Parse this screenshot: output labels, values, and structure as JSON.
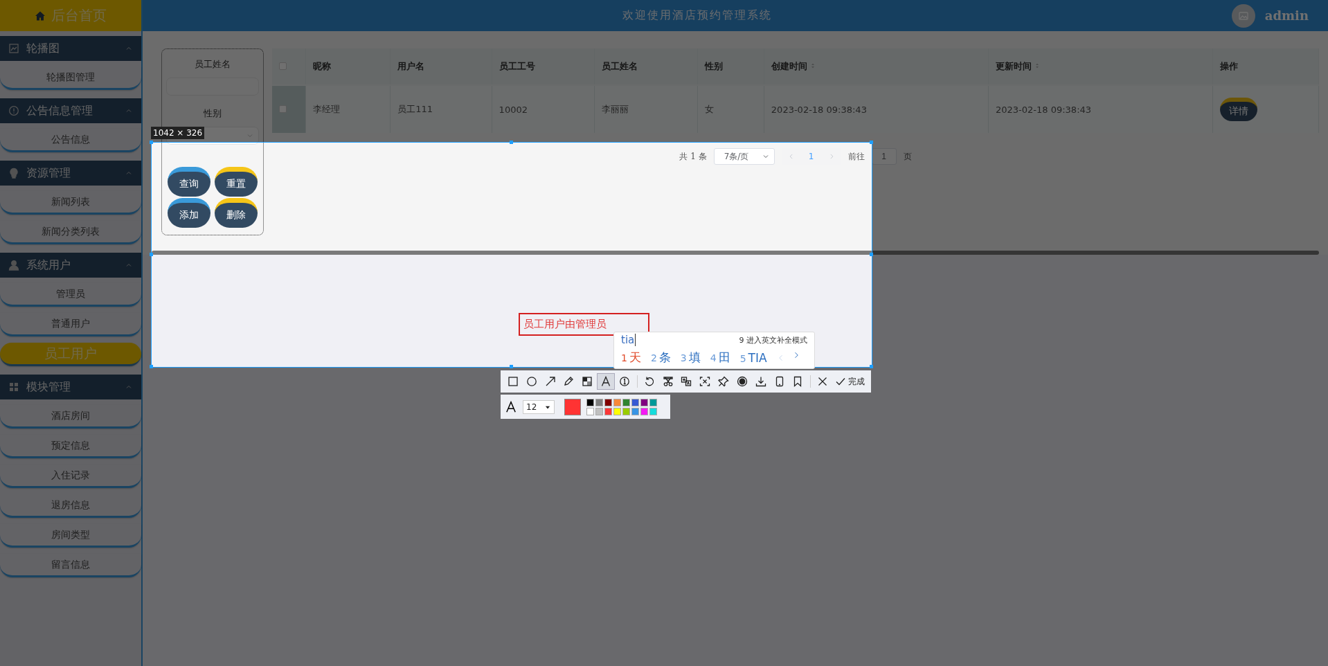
{
  "sidebar": {
    "home": {
      "label": "后台首页"
    },
    "groups": [
      {
        "title": "轮播图",
        "expanded": true,
        "items": [
          {
            "label": "轮播图管理",
            "selected": false
          }
        ]
      },
      {
        "title": "公告信息管理",
        "expanded": true,
        "items": [
          {
            "label": "公告信息",
            "selected": false
          }
        ]
      },
      {
        "title": "资源管理",
        "expanded": true,
        "items": [
          {
            "label": "新闻列表",
            "selected": false
          },
          {
            "label": "新闻分类列表",
            "selected": false
          }
        ]
      },
      {
        "title": "系统用户",
        "expanded": true,
        "items": [
          {
            "label": "管理员",
            "selected": false
          },
          {
            "label": "普通用户",
            "selected": false
          },
          {
            "label": "员工用户",
            "selected": true
          }
        ]
      },
      {
        "title": "模块管理",
        "expanded": true,
        "items": [
          {
            "label": "酒店房间",
            "selected": false
          },
          {
            "label": "预定信息",
            "selected": false
          },
          {
            "label": "入住记录",
            "selected": false
          },
          {
            "label": "退房信息",
            "selected": false
          },
          {
            "label": "房间类型",
            "selected": false
          },
          {
            "label": "留言信息",
            "selected": false
          }
        ]
      }
    ]
  },
  "header": {
    "title": "欢迎使用酒店预约管理系统",
    "user": "admin"
  },
  "search_panel": {
    "fields": [
      {
        "label": "员工姓名",
        "kind": "input"
      },
      {
        "label": "性别",
        "kind": "select"
      }
    ],
    "buttons": [
      {
        "label": "查询",
        "color": "#3a9ad9"
      },
      {
        "label": "重置",
        "color": "#f5c518"
      },
      {
        "label": "添加",
        "color": "#3a9ad9"
      },
      {
        "label": "删除",
        "color": "#f5c518"
      }
    ]
  },
  "table": {
    "all_checked": false,
    "columns": [
      {
        "label": "昵称",
        "sortable": false
      },
      {
        "label": "用户名",
        "sortable": false
      },
      {
        "label": "员工工号",
        "sortable": false
      },
      {
        "label": "员工姓名",
        "sortable": false
      },
      {
        "label": "性别",
        "sortable": false
      },
      {
        "label": "创建时间",
        "sortable": true
      },
      {
        "label": "更新时间",
        "sortable": true
      },
      {
        "label": "操作",
        "sortable": false
      }
    ],
    "rows": [
      {
        "checked": false,
        "cells": [
          "李经理",
          "员工111",
          "10002",
          "李丽丽",
          "女",
          "2023-02-18 09:38:43",
          "2023-02-18 09:38:43"
        ],
        "action": "详情"
      }
    ]
  },
  "pagination": {
    "total": "共 1 条",
    "page_size": "7条/页",
    "pages": [
      {
        "label": "1",
        "selected": true
      }
    ],
    "goto_label": "前往",
    "goto_value": "1",
    "goto_suffix": "页"
  },
  "capture": {
    "size_label": "1042 × 326",
    "annotation_text": "员工用户由管理员",
    "ime": {
      "input": "tia",
      "hint": "9 进入英文补全模式",
      "candidates": [
        {
          "number": "1",
          "text": "天",
          "selected": true
        },
        {
          "number": "2",
          "text": "条",
          "selected": false
        },
        {
          "number": "3",
          "text": "填",
          "selected": false
        },
        {
          "number": "4",
          "text": "田",
          "selected": false
        },
        {
          "number": "5",
          "text": "TIA",
          "selected": false
        }
      ]
    },
    "tool_groups": [
      {
        "tools": [
          {
            "kind": "rect",
            "selected": false
          },
          {
            "kind": "ellipse",
            "selected": false
          },
          {
            "kind": "arrow",
            "selected": false
          },
          {
            "kind": "pencil",
            "selected": false
          },
          {
            "kind": "mosaic",
            "selected": false
          },
          {
            "kind": "text",
            "selected": true
          },
          {
            "kind": "number",
            "selected": false
          }
        ]
      },
      {
        "tools": [
          {
            "kind": "undo",
            "selected": false
          },
          {
            "kind": "scissors",
            "selected": false
          },
          {
            "kind": "translate",
            "selected": false
          },
          {
            "kind": "ocr",
            "selected": false
          },
          {
            "kind": "pin",
            "selected": false
          },
          {
            "kind": "record",
            "selected": false
          },
          {
            "kind": "download",
            "selected": false
          },
          {
            "kind": "phone",
            "selected": false
          },
          {
            "kind": "bookmark",
            "selected": false
          }
        ]
      },
      {
        "tools": [
          {
            "kind": "close",
            "selected": false
          }
        ]
      }
    ],
    "done_label": "完成",
    "font_size": "12",
    "current_swatch": {
      "color": "#ff3333"
    },
    "palette": [
      {
        "color": "#000000",
        "selected": false
      },
      {
        "color": "#808080",
        "selected": false
      },
      {
        "color": "#800000",
        "selected": false
      },
      {
        "color": "#f7883a",
        "selected": false
      },
      {
        "color": "#308430",
        "selected": false
      },
      {
        "color": "#385ad3",
        "selected": false
      },
      {
        "color": "#800080",
        "selected": false
      },
      {
        "color": "#009999",
        "selected": false
      },
      {
        "color": "#ffffff",
        "selected": false
      },
      {
        "color": "#c0c0c0",
        "selected": false
      },
      {
        "color": "#fb3838",
        "selected": false
      },
      {
        "color": "#ffff00",
        "selected": false
      },
      {
        "color": "#99cc00",
        "selected": false
      },
      {
        "color": "#3894e4",
        "selected": false
      },
      {
        "color": "#f31bf3",
        "selected": false
      },
      {
        "color": "#16dcdc",
        "selected": false
      }
    ]
  }
}
